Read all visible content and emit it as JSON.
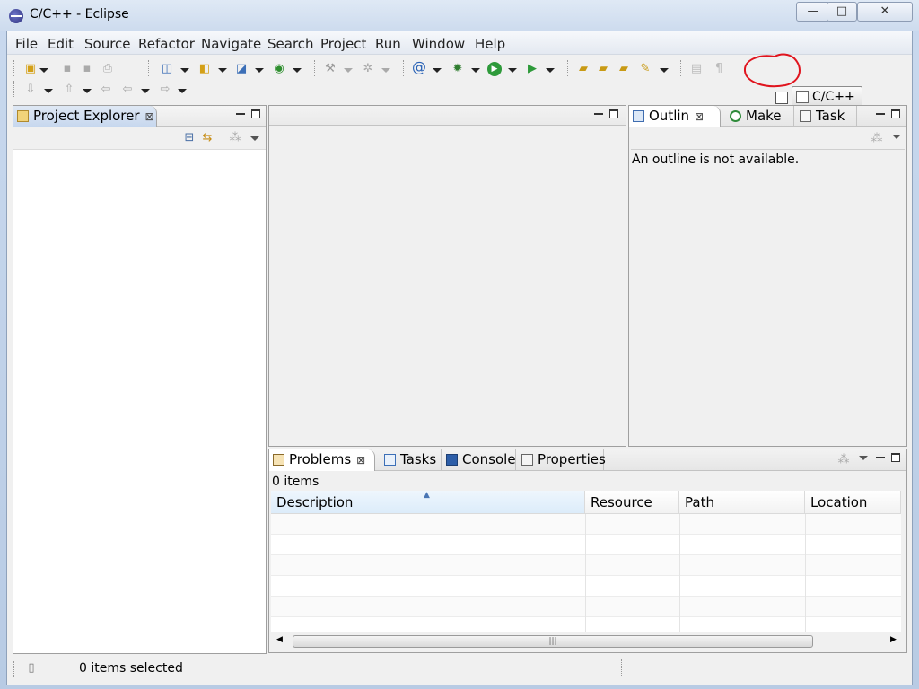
{
  "window": {
    "title": "C/C++ - Eclipse",
    "min_glyph": "—",
    "max_glyph": "□",
    "close_glyph": "✕"
  },
  "menu": [
    "File",
    "Edit",
    "Source",
    "Refactor",
    "Navigate",
    "Search",
    "Project",
    "Run",
    "Window",
    "Help"
  ],
  "toolbar": {
    "perspective_label": "C/C++",
    "open_perspective_icon": "open-perspective-icon"
  },
  "project_explorer": {
    "tab_label": "Project Explorer",
    "close_glyph": "⊠"
  },
  "outline": {
    "tabs": [
      {
        "label": "Outlin",
        "icon": "outline-icon",
        "active": true,
        "close_glyph": "⊠"
      },
      {
        "label": "Make",
        "icon": "make-target-icon",
        "active": false
      },
      {
        "label": "Task",
        "icon": "task-list-icon",
        "active": false
      }
    ],
    "message": "An outline is not available."
  },
  "bottom": {
    "tabs": [
      {
        "label": "Problems",
        "icon": "problems-icon",
        "active": true,
        "close_glyph": "⊠"
      },
      {
        "label": "Tasks",
        "icon": "tasks-icon",
        "active": false
      },
      {
        "label": "Console",
        "icon": "console-icon",
        "active": false
      },
      {
        "label": "Properties",
        "icon": "properties-icon",
        "active": false
      }
    ],
    "item_count": "0 items",
    "columns": [
      "Description",
      "Resource",
      "Path",
      "Location"
    ],
    "scroll_grip": "|||"
  },
  "status": {
    "text": "0 items selected"
  },
  "colors": {
    "accent_red_circle": "#e0141e",
    "sorted_header": "#dcecfa"
  }
}
